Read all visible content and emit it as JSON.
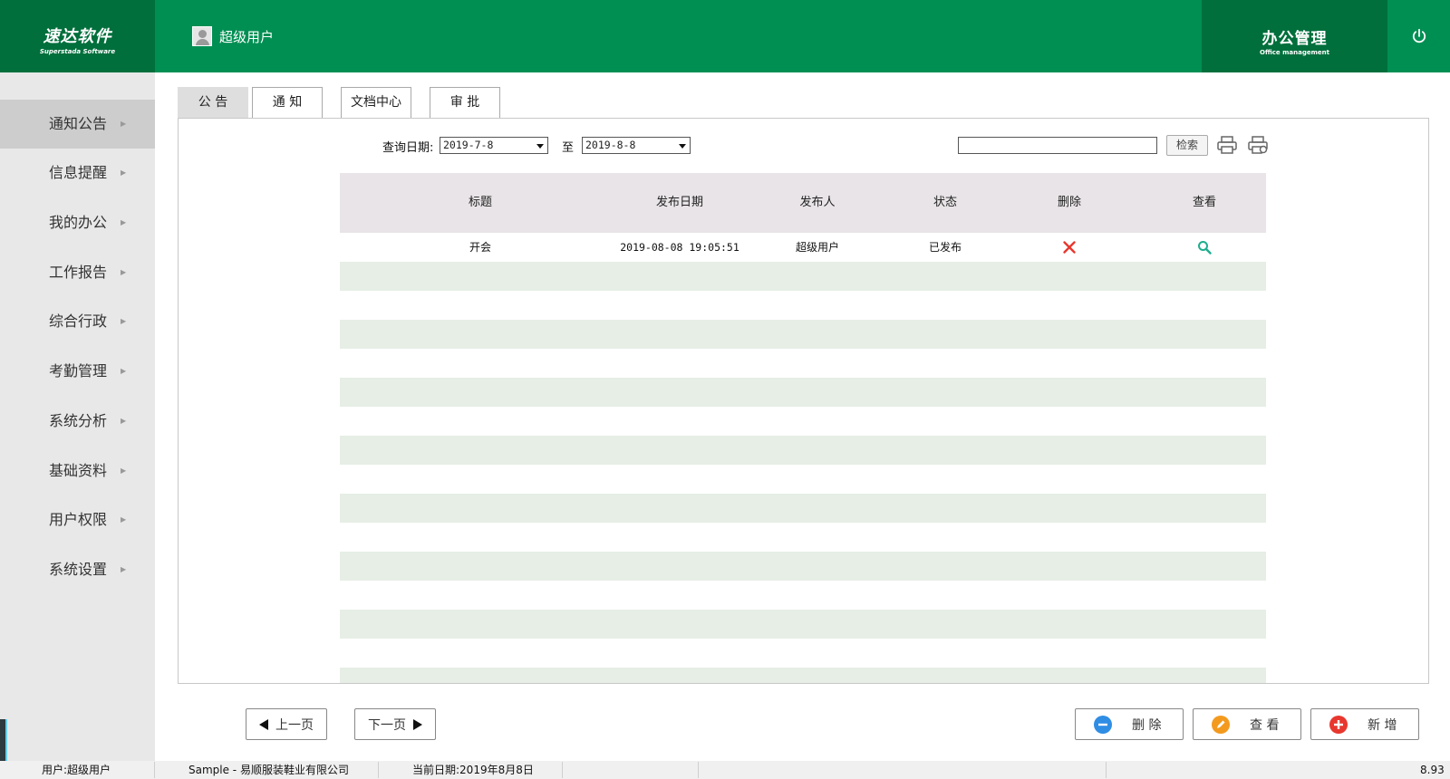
{
  "header": {
    "brand_cn": "速达软件",
    "brand_en": "Superstada Software",
    "user_name": "超级用户",
    "module_cn": "办公管理",
    "module_en": "Office management"
  },
  "sidebar": {
    "items": [
      {
        "label": "通知公告",
        "active": true
      },
      {
        "label": "信息提醒"
      },
      {
        "label": "我的办公"
      },
      {
        "label": "工作报告"
      },
      {
        "label": "综合行政"
      },
      {
        "label": "考勤管理"
      },
      {
        "label": "系统分析"
      },
      {
        "label": "基础资料"
      },
      {
        "label": "用户权限"
      },
      {
        "label": "系统设置"
      }
    ]
  },
  "tabs": [
    {
      "label": "公  告",
      "active": true
    },
    {
      "label": "通  知"
    },
    {
      "label": "文档中心"
    },
    {
      "label": "审  批"
    }
  ],
  "query": {
    "date_label": "查询日期:",
    "start_date": "2019-7-8",
    "to_label": "至",
    "end_date": "2019-8-8",
    "search_value": "",
    "search_button": "检索"
  },
  "table": {
    "columns": [
      "标题",
      "发布日期",
      "发布人",
      "状态",
      "删除",
      "查看"
    ],
    "rows": [
      {
        "title": "开会",
        "date": "2019-08-08 19:05:51",
        "publisher": "超级用户",
        "status": "已发布",
        "delete_icon": "close-icon",
        "view_icon": "search-icon"
      }
    ]
  },
  "pager": {
    "prev": "上一页",
    "next": "下一页"
  },
  "actions": {
    "delete": "删 除",
    "view": "查 看",
    "add": "新 增"
  },
  "status_bar": {
    "user": "用户:超级用户",
    "company": "Sample - 易顺服装鞋业有限公司",
    "date": "当前日期:2019年8月8日",
    "version": "8.93"
  },
  "colors": {
    "header_green": "#008f53",
    "dark_green": "#006f3c",
    "stripe": "#e6eee6",
    "delete_red": "#e8372e",
    "view_teal": "#1fae8e",
    "minus_blue": "#2f8de4",
    "edit_orange": "#f39a1e",
    "plus_red": "#e8372e"
  }
}
